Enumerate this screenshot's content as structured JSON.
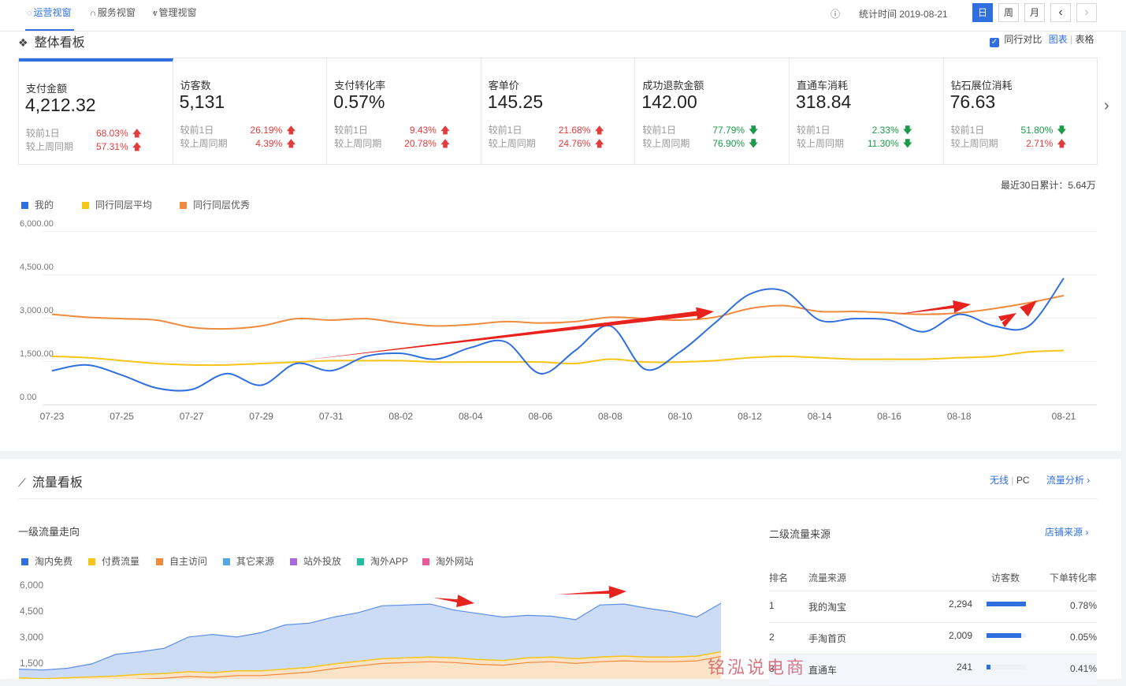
{
  "topbar": {
    "tabs": [
      {
        "label": "运营视窗",
        "icon": "shield-icon"
      },
      {
        "label": "服务视窗",
        "icon": "headset-icon"
      },
      {
        "label": "管理视窗",
        "icon": "hand-icon"
      }
    ],
    "info_icon": "info-icon",
    "stat_time": "统计时间 2019-08-21",
    "day": "日",
    "week": "周",
    "month": "月",
    "prev": "‹",
    "next": "›"
  },
  "overview": {
    "title": "整体看板",
    "compare_label": "同行对比",
    "view_chart": "图表",
    "view_sep": "|",
    "view_table": "表格",
    "cumulative": "最近30日累计：5.64万",
    "compare_day": "较前1日",
    "compare_week": "较上周同期",
    "cards": [
      {
        "name": "支付金额",
        "value": "4,212.32",
        "d1": "68.03%",
        "d1dir": "up",
        "w1": "57.31%",
        "w1dir": "up"
      },
      {
        "name": "访客数",
        "value": "5,131",
        "d1": "26.19%",
        "d1dir": "up",
        "w1": "4.39%",
        "w1dir": "up"
      },
      {
        "name": "支付转化率",
        "value": "0.57%",
        "d1": "9.43%",
        "d1dir": "up",
        "w1": "20.78%",
        "w1dir": "up"
      },
      {
        "name": "客单价",
        "value": "145.25",
        "d1": "21.68%",
        "d1dir": "up",
        "w1": "24.76%",
        "w1dir": "up"
      },
      {
        "name": "成功退款金额",
        "value": "142.00",
        "d1": "77.79%",
        "d1dir": "down",
        "w1": "76.90%",
        "w1dir": "down"
      },
      {
        "name": "直通车消耗",
        "value": "318.84",
        "d1": "2.33%",
        "d1dir": "down",
        "w1": "11.30%",
        "w1dir": "down"
      },
      {
        "name": "钻石展位消耗",
        "value": "76.63",
        "d1": "51.80%",
        "d1dir": "down",
        "w1": "2.71%",
        "w1dir": "up"
      }
    ],
    "arrow_up": "🡅",
    "arrow_down": "🡇",
    "next_cards": "›"
  },
  "chart_data": [
    {
      "type": "line",
      "x": [
        "07-23",
        "07-24",
        "07-25",
        "07-26",
        "07-27",
        "07-28",
        "07-29",
        "07-30",
        "07-31",
        "08-01",
        "08-02",
        "08-03",
        "08-04",
        "08-05",
        "08-06",
        "08-07",
        "08-08",
        "08-09",
        "08-10",
        "08-11",
        "08-12",
        "08-13",
        "08-14",
        "08-15",
        "08-16",
        "08-17",
        "08-18",
        "08-19",
        "08-20",
        "08-21"
      ],
      "xticks": [
        "07-23",
        "07-25",
        "07-27",
        "07-29",
        "07-31",
        "08-02",
        "08-04",
        "08-06",
        "08-08",
        "08-10",
        "08-12",
        "08-14",
        "08-16",
        "08-18",
        "08-21"
      ],
      "yticks": [
        "6,000.00",
        "4,500.00",
        "3,000.00",
        "1,500.00",
        "0.00"
      ],
      "ylim": [
        0,
        6000
      ],
      "series": [
        {
          "name": "我的",
          "color": "#2f6fe0",
          "values": [
            950,
            1150,
            800,
            350,
            300,
            850,
            450,
            1200,
            950,
            1450,
            1550,
            1350,
            1750,
            1950,
            850,
            1650,
            2500,
            1000,
            1600,
            2600,
            3600,
            3700,
            2700,
            2750,
            2700,
            2300,
            2900,
            2500,
            2500,
            4150
          ]
        },
        {
          "name": "同行同层平均",
          "color": "#f5c518",
          "values": [
            1450,
            1400,
            1300,
            1200,
            1150,
            1150,
            1200,
            1250,
            1300,
            1300,
            1300,
            1250,
            1250,
            1250,
            1250,
            1200,
            1350,
            1250,
            1250,
            1300,
            1400,
            1450,
            1400,
            1350,
            1350,
            1350,
            1400,
            1450,
            1600,
            1650
          ]
        },
        {
          "name": "同行同层优秀",
          "color": "#f08a3c",
          "values": [
            2900,
            2800,
            2750,
            2700,
            2450,
            2400,
            2500,
            2750,
            2700,
            2750,
            2600,
            2500,
            2550,
            2650,
            2600,
            2650,
            2800,
            2750,
            2700,
            2800,
            3100,
            3200,
            3000,
            3000,
            2950,
            2900,
            2950,
            3100,
            3300,
            3550
          ]
        }
      ]
    },
    {
      "type": "area",
      "yticks": [
        "6,000",
        "4,500",
        "3,000",
        "1,500"
      ],
      "ylim": [
        0,
        6000
      ],
      "series": [
        {
          "name": "淘内免费",
          "color": "#2f6fe0",
          "values": [
            1200,
            1150,
            1250,
            1500,
            2050,
            2200,
            2400,
            3050,
            3200,
            3050,
            3300,
            3750,
            3850,
            4200,
            4450,
            4850,
            4900,
            4950,
            4600,
            4400,
            4200,
            4300,
            4250,
            4050,
            4900,
            4950,
            4700,
            4500,
            4200,
            5000
          ]
        },
        {
          "name": "付费流量",
          "color": "#f5c518",
          "values": [
            700,
            650,
            700,
            750,
            800,
            900,
            950,
            1050,
            1000,
            1100,
            1100,
            1200,
            1300,
            1500,
            1650,
            1800,
            1850,
            1900,
            1850,
            1750,
            1700,
            1850,
            1900,
            1800,
            1900,
            1950,
            1900,
            1900,
            1950,
            2200
          ]
        },
        {
          "name": "自主访问",
          "color": "#f08a3c",
          "values": [
            0,
            0,
            0,
            0,
            0,
            0,
            0,
            0,
            0,
            0,
            0,
            0,
            0,
            0,
            0,
            0,
            0,
            0,
            0,
            0,
            0,
            0,
            0,
            0,
            0,
            0,
            0,
            0,
            0,
            0
          ]
        },
        {
          "name": "其它来源",
          "color": "#52a8e8",
          "values": []
        },
        {
          "name": "站外投放",
          "color": "#a86ad8",
          "values": []
        },
        {
          "name": "淘外APP",
          "color": "#1fbf9f",
          "values": []
        },
        {
          "name": "淘外网站",
          "color": "#e85a9a",
          "values": []
        }
      ]
    },
    {
      "type": "table",
      "columns": [
        "排名",
        "流量来源",
        "访客数",
        "下单转化率"
      ],
      "rows": [
        [
          "1",
          "我的淘宝",
          "2,294",
          "0.78%"
        ],
        [
          "2",
          "手淘首页",
          "2,009",
          "0.05%"
        ],
        [
          "3",
          "直通车",
          "241",
          "0.41%"
        ]
      ],
      "bar_fraction": [
        1.0,
        0.876,
        0.105
      ]
    }
  ],
  "traffic": {
    "title": "流量看板",
    "wireless": "无线",
    "sep": "|",
    "pc": "PC",
    "analysis": "流量分析",
    "trend_title": "一级流量走向",
    "source_title": "二级流量来源",
    "store_source": "店铺来源",
    "chev": "›"
  },
  "watermark": "铭泓说电商",
  "colors": {
    "accent": "#2f6fe0",
    "up": "#e23c3c",
    "down": "#1b9a4a",
    "annotation": "#e8231e"
  }
}
